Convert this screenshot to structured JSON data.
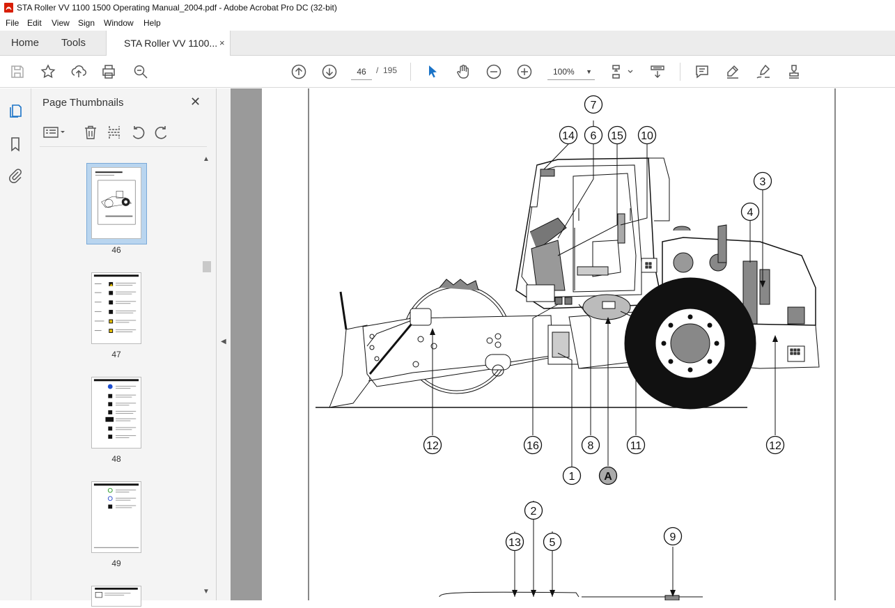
{
  "window": {
    "title": "STA Roller VV 1100 1500 Operating Manual_2004.pdf - Adobe Acrobat Pro DC (32-bit)"
  },
  "menu": [
    "File",
    "Edit",
    "View",
    "Sign",
    "Window",
    "Help"
  ],
  "tabs": {
    "home": "Home",
    "tools": "Tools",
    "document": "STA Roller VV 1100...",
    "close_glyph": "×"
  },
  "toolbar": {
    "current_page": "46",
    "page_separator": "/",
    "total_pages": "195",
    "zoom": "100%",
    "icons": [
      "save-icon",
      "bookmark-star-icon",
      "upload-icon",
      "print-icon",
      "search-zoom-icon",
      "page-up-icon",
      "page-down-icon",
      "select-cursor-icon",
      "hand-icon",
      "zoom-out-icon",
      "zoom-in-icon",
      "page-fit-icon",
      "scroll-mode-icon",
      "comment-icon",
      "highlight-icon",
      "sign-icon",
      "stamp-icon"
    ]
  },
  "sidebar": {
    "title": "Page Thumbnails",
    "thumbnails": [
      {
        "label": "46",
        "selected": true
      },
      {
        "label": "47",
        "selected": false
      },
      {
        "label": "48",
        "selected": false
      },
      {
        "label": "49",
        "selected": false
      }
    ]
  },
  "figure": {
    "callouts": [
      "7",
      "14",
      "6",
      "15",
      "10",
      "3",
      "4",
      "12",
      "16",
      "8",
      "11",
      "12",
      "1",
      "A",
      "2",
      "13",
      "5",
      "9"
    ]
  },
  "colors": {
    "accent": "#1a73c7",
    "doc_background": "#9a9a9a",
    "selected_thumb": "#b9d5ef"
  }
}
